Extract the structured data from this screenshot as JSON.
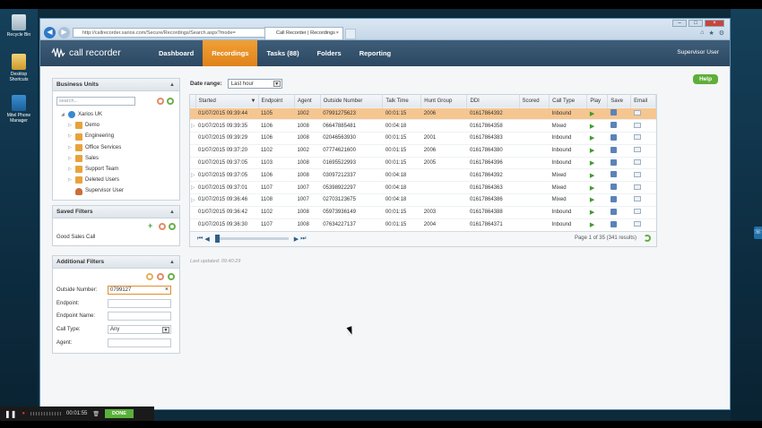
{
  "desktop": {
    "icons": [
      {
        "label": "Recycle Bin"
      },
      {
        "label": "Desktop Shortcuts"
      },
      {
        "label": "Mitel Phone Manager"
      }
    ]
  },
  "browser": {
    "address": "http://callrecorder.xarios.com/Secure/Recordings/Search.aspx?mode=",
    "tab_title": "Call Recorder | Recordings",
    "tab_close": "×"
  },
  "app": {
    "logo_text": "call recorder",
    "menu": [
      "Dashboard",
      "Recordings",
      "Tasks (88)",
      "Folders",
      "Reporting"
    ],
    "active_menu": "Recordings",
    "user": "Supervisor User",
    "help": "Help"
  },
  "business_units": {
    "title": "Business Units",
    "search_placeholder": "search...",
    "tree": [
      {
        "label": "Xarios UK",
        "level": 0
      },
      {
        "label": "Demo",
        "level": 1
      },
      {
        "label": "Engineering",
        "level": 1
      },
      {
        "label": "Office Services",
        "level": 1
      },
      {
        "label": "Sales",
        "level": 1
      },
      {
        "label": "Support Team",
        "level": 1
      },
      {
        "label": "Deleted Users",
        "level": 1
      },
      {
        "label": "Supervisor User",
        "level": 1
      }
    ]
  },
  "saved_filters": {
    "title": "Saved Filters",
    "items": [
      "Good Sales Call"
    ]
  },
  "additional_filters": {
    "title": "Additional Filters",
    "outside_number_label": "Outside Number:",
    "outside_number_value": "0799127",
    "endpoint_label": "Endpoint:",
    "endpoint_name_label": "Endpoint Name:",
    "call_type_label": "Call Type:",
    "call_type_value": "Any",
    "agent_label": "Agent:"
  },
  "results": {
    "date_range_label": "Date range:",
    "date_range_value": "Last hour",
    "columns": [
      "Started",
      "Endpoint",
      "Agent",
      "Outside Number",
      "Talk Time",
      "Hunt Group",
      "DDI",
      "Scored",
      "Call Type",
      "Play",
      "Save",
      "Email"
    ],
    "rows": [
      {
        "started": "01/07/2015 09:39:44",
        "endpoint": "1105",
        "agent": "1002",
        "outside": "07991275623",
        "talk": "00:01:15",
        "hunt": "2006",
        "ddi": "01617864392",
        "scored": "",
        "type": "Inbound"
      },
      {
        "started": "01/07/2015 09:39:35",
        "endpoint": "1106",
        "agent": "1008",
        "outside": "06647885481",
        "talk": "00:04:18",
        "hunt": "",
        "ddi": "01617864358",
        "scored": "",
        "type": "Mixed"
      },
      {
        "started": "01/07/2015 09:39:29",
        "endpoint": "1106",
        "agent": "1008",
        "outside": "02046563930",
        "talk": "00:01:15",
        "hunt": "2001",
        "ddi": "01617864383",
        "scored": "",
        "type": "Inbound"
      },
      {
        "started": "01/07/2015 09:37:20",
        "endpoint": "1102",
        "agent": "1002",
        "outside": "07774621600",
        "talk": "00:01:15",
        "hunt": "2006",
        "ddi": "01617864380",
        "scored": "",
        "type": "Inbound"
      },
      {
        "started": "01/07/2015 09:37:05",
        "endpoint": "1103",
        "agent": "1008",
        "outside": "01695522993",
        "talk": "00:01:15",
        "hunt": "2005",
        "ddi": "01617864396",
        "scored": "",
        "type": "Inbound"
      },
      {
        "started": "01/07/2015 09:37:05",
        "endpoint": "1106",
        "agent": "1008",
        "outside": "03097212337",
        "talk": "00:04:18",
        "hunt": "",
        "ddi": "01617864392",
        "scored": "",
        "type": "Mixed"
      },
      {
        "started": "01/07/2015 09:37:01",
        "endpoint": "1107",
        "agent": "1007",
        "outside": "05398922297",
        "talk": "00:04:18",
        "hunt": "",
        "ddi": "01617864363",
        "scored": "",
        "type": "Mixed"
      },
      {
        "started": "01/07/2015 09:36:46",
        "endpoint": "1108",
        "agent": "1007",
        "outside": "02703123675",
        "talk": "00:04:18",
        "hunt": "",
        "ddi": "01617864386",
        "scored": "",
        "type": "Mixed"
      },
      {
        "started": "01/07/2015 09:36:42",
        "endpoint": "1102",
        "agent": "1008",
        "outside": "05973936149",
        "talk": "00:01:15",
        "hunt": "2003",
        "ddi": "01617864388",
        "scored": "",
        "type": "Inbound"
      },
      {
        "started": "01/07/2015 09:36:30",
        "endpoint": "1107",
        "agent": "1008",
        "outside": "07634227137",
        "talk": "00:01:15",
        "hunt": "2004",
        "ddi": "01617864371",
        "scored": "",
        "type": "Inbound"
      }
    ],
    "pager_info": "Page 1 of 35 (341 results)",
    "last_updated": "Last updated: 09:40:29"
  },
  "recorder": {
    "time": "00:01:55",
    "done": "DONE"
  }
}
